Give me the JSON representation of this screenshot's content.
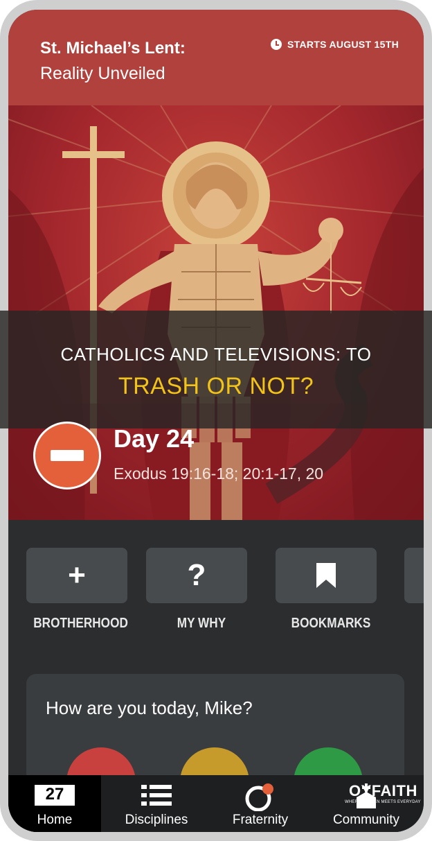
{
  "header": {
    "title": "St. Michael’s Lent:",
    "subtitle": "Reality Unveiled",
    "start_label": "STARTS AUGUST 15TH"
  },
  "overlay": {
    "line1": "CATHOLICS AND TELEVISIONS: TO",
    "line2": "TRASH OR NOT?"
  },
  "day": {
    "title": "Day 24",
    "reading": "Exodus 19:16-18; 20:1-17, 20"
  },
  "quick_actions": [
    {
      "label": "BROTHERHOOD",
      "icon": "plus-icon",
      "glyph": "+"
    },
    {
      "label": "MY WHY",
      "icon": "question-icon",
      "glyph": "?"
    },
    {
      "label": "BOOKMARKS",
      "icon": "bookmark-icon",
      "glyph": ""
    }
  ],
  "mood": {
    "question": "How are you today, Mike?"
  },
  "tabs": [
    {
      "label": "Home",
      "icon": "calendar-icon",
      "badge": "27"
    },
    {
      "label": "Disciplines",
      "icon": "list-icon"
    },
    {
      "label": "Fraternity",
      "icon": "chat-icon"
    },
    {
      "label": "Community",
      "icon": "church-icon"
    }
  ],
  "watermark": {
    "text": "OYFAITH",
    "tagline": "WHERE HEAVEN MEETS EVERYDAY"
  },
  "colors": {
    "header_bg": "#b1413c",
    "accent_orange": "#e4603b",
    "overlay_yellow": "#f2c318",
    "mood_red": "#c9413e",
    "mood_yellow": "#c79a2c",
    "mood_green": "#2e9a46"
  }
}
